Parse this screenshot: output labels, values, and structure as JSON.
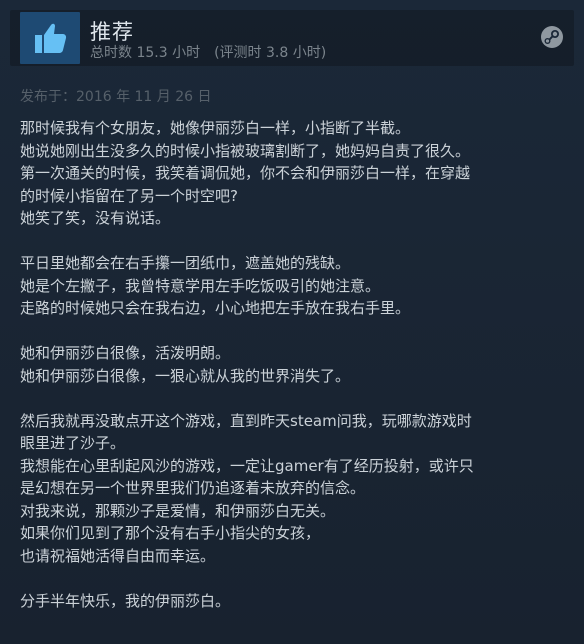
{
  "review": {
    "verdict": "推荐",
    "hours_on_record": "总时数 15.3 小时",
    "hours_at_review": "(评测时 3.8 小时)",
    "posted": "发布于：2016 年 11 月 26 日",
    "paragraphs": [
      [
        "那时候我有个女朋友，她像伊丽莎白一样，小指断了半截。",
        "她说她刚出生没多久的时候小指被玻璃割断了，她妈妈自责了很久。",
        "第一次通关的时候，我笑着调侃她，你不会和伊丽莎白一样，在穿越",
        "的时候小指留在了另一个时空吧?",
        "她笑了笑，没有说话。"
      ],
      [
        "平日里她都会在右手攥一团纸巾，遮盖她的残缺。",
        "她是个左撇子，我曾特意学用左手吃饭吸引的她注意。",
        "走路的时候她只会在我右边，小心地把左手放在我右手里。"
      ],
      [
        "她和伊丽莎白很像，活泼明朗。",
        "她和伊丽莎白很像，一狠心就从我的世界消失了。"
      ],
      [
        "然后我就再没敢点开这个游戏，直到昨天steam问我，玩哪款游戏时",
        "眼里进了沙子。",
        "我想能在心里刮起风沙的游戏，一定让gamer有了经历投射，或许只",
        "是幻想在另一个世界里我们仍追逐着未放弃的信念。",
        "对我来说，那颗沙子是爱情，和伊丽莎白无关。",
        "如果你们见到了那个没有右手小指尖的女孩，",
        "也请祝福她活得自由而幸运。"
      ],
      [
        "分手半年快乐，我的伊丽莎白。"
      ]
    ]
  },
  "icons": {
    "verdict_icon": "thumbs-up-icon",
    "platform_icon": "steam-icon"
  },
  "colors": {
    "background": "#1b2838",
    "thumb_box": "#1e4a73",
    "title_text": "#dfe6ec",
    "body_text": "#cbd2d8",
    "muted_text": "#7b848c"
  }
}
